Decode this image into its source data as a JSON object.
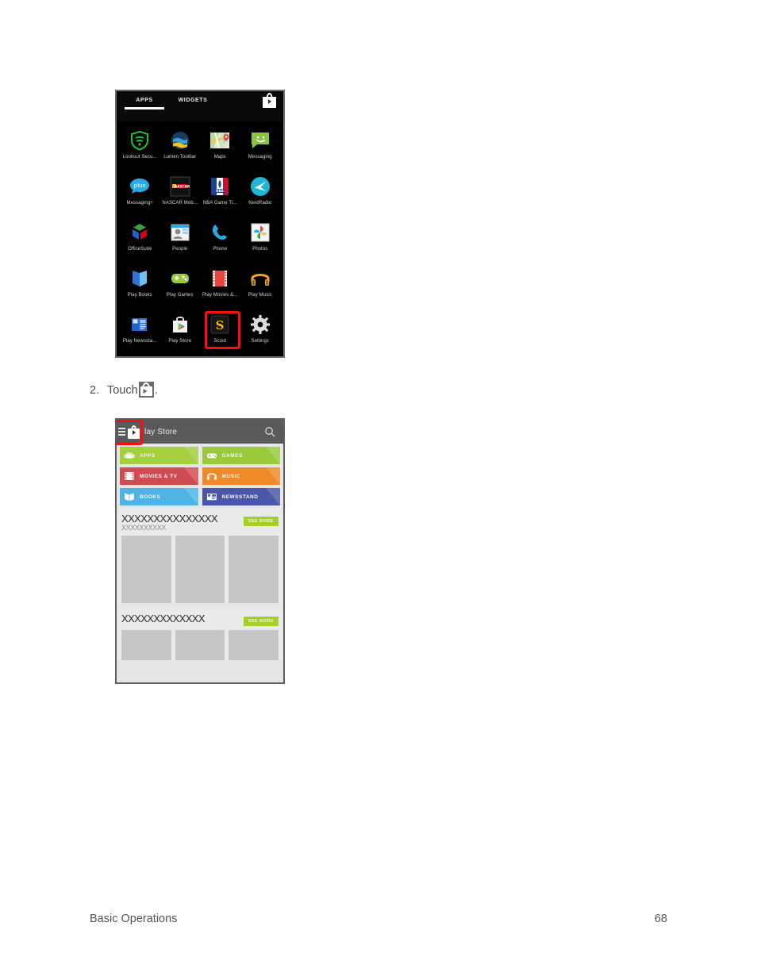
{
  "page": {
    "footer_left": "Basic Operations",
    "footer_page_number": "68"
  },
  "step": {
    "number": "2.",
    "text": "Touch",
    "trailing": ".",
    "icon": "play-store-bag-icon"
  },
  "apps_screenshot": {
    "tabs": [
      {
        "label": "APPS",
        "selected": true
      },
      {
        "label": "WIDGETS",
        "selected": false
      }
    ],
    "header_icon": "play-store-bag-icon",
    "rows": [
      [
        {
          "label": "Lookout Secu...",
          "icon": "lookout-security-icon"
        },
        {
          "label": "Lumen Toolbar",
          "icon": "lumen-toolbar-icon"
        },
        {
          "label": "Maps",
          "icon": "maps-icon"
        },
        {
          "label": "Messaging",
          "icon": "messaging-icon"
        }
      ],
      [
        {
          "label": "Messaging+",
          "icon": "messaging-plus-icon"
        },
        {
          "label": "NASCAR Mob...",
          "icon": "nascar-mobile-icon"
        },
        {
          "label": "NBA Game Ti...",
          "icon": "nba-game-time-icon"
        },
        {
          "label": "NextRadio",
          "icon": "nextradio-icon"
        }
      ],
      [
        {
          "label": "OfficeSuite",
          "icon": "officesuite-icon"
        },
        {
          "label": "People",
          "icon": "people-icon"
        },
        {
          "label": "Phone",
          "icon": "phone-icon"
        },
        {
          "label": "Photos",
          "icon": "photos-icon"
        }
      ],
      [
        {
          "label": "Play Books",
          "icon": "play-books-icon"
        },
        {
          "label": "Play Games",
          "icon": "play-games-icon"
        },
        {
          "label": "Play Movies &...",
          "icon": "play-movies-icon"
        },
        {
          "label": "Play Music",
          "icon": "play-music-icon"
        }
      ],
      [
        {
          "label": "Play Newssta...",
          "icon": "play-newsstand-icon"
        },
        {
          "label": "Play Store",
          "icon": "play-store-icon",
          "highlighted": true
        },
        {
          "label": "Scout",
          "icon": "scout-icon"
        },
        {
          "label": "Settings",
          "icon": "settings-icon"
        }
      ]
    ]
  },
  "playstore_screenshot": {
    "header": {
      "menu_icon": "hamburger-menu-icon",
      "logo_icon": "play-store-bag-icon",
      "title": "lay Store",
      "search_icon": "search-icon",
      "highlighted": true
    },
    "categories": [
      {
        "label": "APPS",
        "icon": "android-robot-icon",
        "color": "#a4cf3e"
      },
      {
        "label": "GAMES",
        "icon": "gamepad-icon",
        "color": "#9ac93b"
      },
      {
        "label": "MOVIES & TV",
        "icon": "film-strip-icon",
        "color": "#d14c52"
      },
      {
        "label": "MUSIC",
        "icon": "headphones-icon",
        "color": "#f08a27"
      },
      {
        "label": "BOOKS",
        "icon": "open-book-icon",
        "color": "#4fb3e8"
      },
      {
        "label": "NEWSSTAND",
        "icon": "newspaper-icon",
        "color": "#4a56a6"
      }
    ],
    "sections": [
      {
        "title": "XXXXXXXXXXXXXXX",
        "subtitle": "XXXXXXXXXX",
        "see_more_label": "SEE MORE",
        "card_count": 3,
        "card_size": "tall"
      },
      {
        "title": "XXXXXXXXXXXXX",
        "subtitle": "",
        "see_more_label": "SEE MORE",
        "card_count": 3,
        "card_size": "short"
      }
    ]
  }
}
